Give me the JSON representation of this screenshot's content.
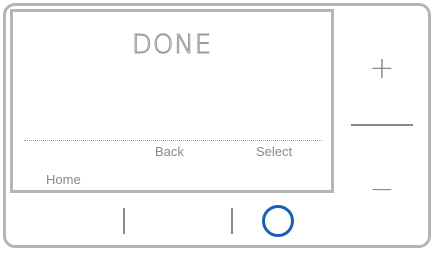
{
  "screen": {
    "title": "DONE",
    "softkeys": {
      "back_label": "Back",
      "select_label": "Select",
      "home_label": "Home"
    }
  },
  "side_buttons": {
    "plus_label": "+",
    "minus_label": "−"
  },
  "colors": {
    "frame": "#b5b5b5",
    "text": "#8a8a8a",
    "accent": "#1a5fb4"
  },
  "icons": {
    "left_button": "vertical-bar-icon",
    "middle_button": "vertical-bar-icon",
    "right_button": "circle-icon"
  }
}
